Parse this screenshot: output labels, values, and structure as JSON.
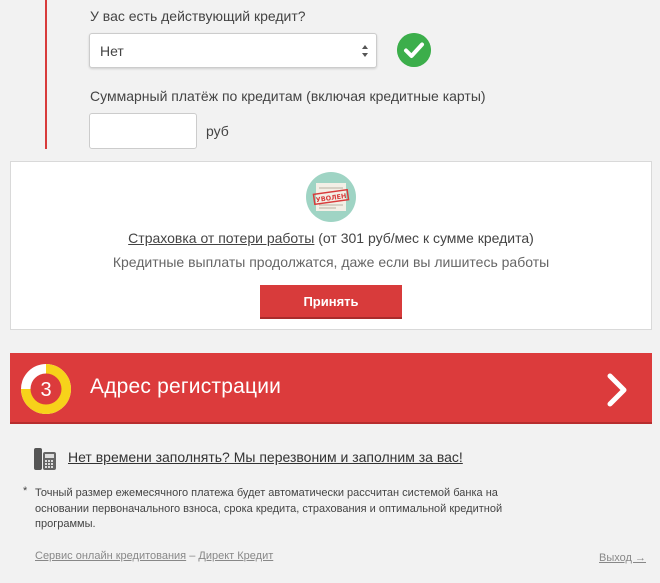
{
  "credit_question": {
    "label": "У вас есть действующий кредит?",
    "selected_value": "Нет"
  },
  "payment": {
    "label": "Суммарный платёж по кредитам (включая кредитные карты)",
    "value": "",
    "unit": "руб"
  },
  "insurance": {
    "badge_text": "УВОЛЕН",
    "link_text": "Страховка от потери работы",
    "price_text": " (от 301 руб/мес к сумме кредита)",
    "subtitle": "Кредитные выплаты продолжатся, даже если вы лишитесь работы",
    "accept_label": "Принять"
  },
  "step": {
    "number": "3",
    "title": "Адрес регистрации"
  },
  "callback": {
    "text": "Нет времени заполнять? Мы перезвоним и заполним за вас!"
  },
  "footnote": {
    "star": "*",
    "text": "Точный размер ежемесячного платежа будет автоматически рассчитан системой банка на основании первоначального взноса, срока кредита, страхования и оптимальной кредитной программы."
  },
  "footer": {
    "service_link": "Сервис онлайн кредитования",
    "separator": " – ",
    "brand_link": "Директ Кредит",
    "exit_link": "Выход →"
  },
  "colors": {
    "accent_red": "#dc3b3c",
    "success_green": "#3cae4b",
    "ring_yellow": "#f7d21a"
  }
}
